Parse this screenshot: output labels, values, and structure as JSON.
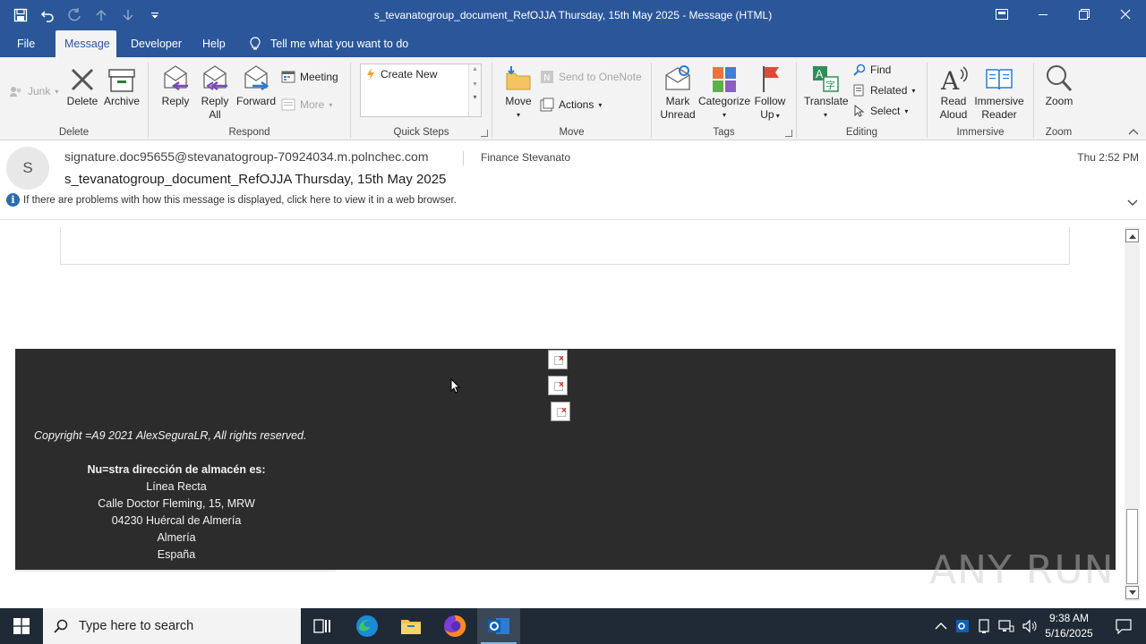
{
  "window": {
    "title": "s_tevanatogroup_document_RefOJJA Thursday, 15th May 2025  -  Message (HTML)",
    "qat_icons": [
      "save-icon",
      "undo-icon",
      "redo-icon",
      "up-arrow-icon",
      "down-arrow-icon",
      "customize-icon"
    ]
  },
  "tabs": {
    "items": [
      "File",
      "Message",
      "Developer",
      "Help"
    ],
    "active": "Message",
    "tell_me": "Tell me what you want to do"
  },
  "ribbon": {
    "delete_group": {
      "label": "Delete",
      "junk": "Junk",
      "delete": "Delete",
      "archive": "Archive"
    },
    "respond_group": {
      "label": "Respond",
      "reply": "Reply",
      "reply_all_1": "Reply",
      "reply_all_2": "All",
      "forward": "Forward",
      "meeting": "Meeting",
      "more": "More"
    },
    "quicksteps_group": {
      "label": "Quick Steps",
      "create_new": "Create New"
    },
    "move_group": {
      "label": "Move",
      "move": "Move",
      "send_onenote": "Send to OneNote",
      "actions": "Actions"
    },
    "tags_group": {
      "label": "Tags",
      "mark_unread_1": "Mark",
      "mark_unread_2": "Unread",
      "categorize": "Categorize",
      "follow_up_1": "Follow",
      "follow_up_2": "Up"
    },
    "editing_group": {
      "label": "Editing",
      "translate": "Translate",
      "find": "Find",
      "related": "Related",
      "select": "Select"
    },
    "immersive_group": {
      "label": "Immersive",
      "read_aloud_1": "Read",
      "read_aloud_2": "Aloud",
      "immersive_reader_1": "Immersive",
      "immersive_reader_2": "Reader"
    },
    "zoom_group": {
      "label": "Zoom",
      "zoom": "Zoom"
    }
  },
  "message": {
    "avatar_initial": "S",
    "sender": "signature.doc95655@stevanatogroup-70924034.m.polnchec.com",
    "recipient": "Finance Stevanato",
    "time": "Thu 2:52 PM",
    "subject": "s_tevanatogroup_document_RefOJJA Thursday, 15th May 2025",
    "info_bar": "If there are problems with how this message is displayed, click here to view it in a web browser."
  },
  "body": {
    "copyright": "Copyright =A9 2021  AlexSeguraLR, All rights reserved.",
    "address_heading": "Nu=stra dirección de almacén es:",
    "address_lines": [
      "Línea Recta",
      "Calle Doctor Fleming, 15,  MRW",
      "04230  Huércal de Almería",
      "Almería",
      "España"
    ]
  },
  "watermark": "ANY RUN",
  "taskbar": {
    "search_placeholder": "Type here to search",
    "time": "9:38 AM",
    "date": "5/16/2025"
  },
  "colors": {
    "titlebar": "#2b579a",
    "dark_band": "#2c2c2c",
    "taskbar": "#1f2a36"
  }
}
